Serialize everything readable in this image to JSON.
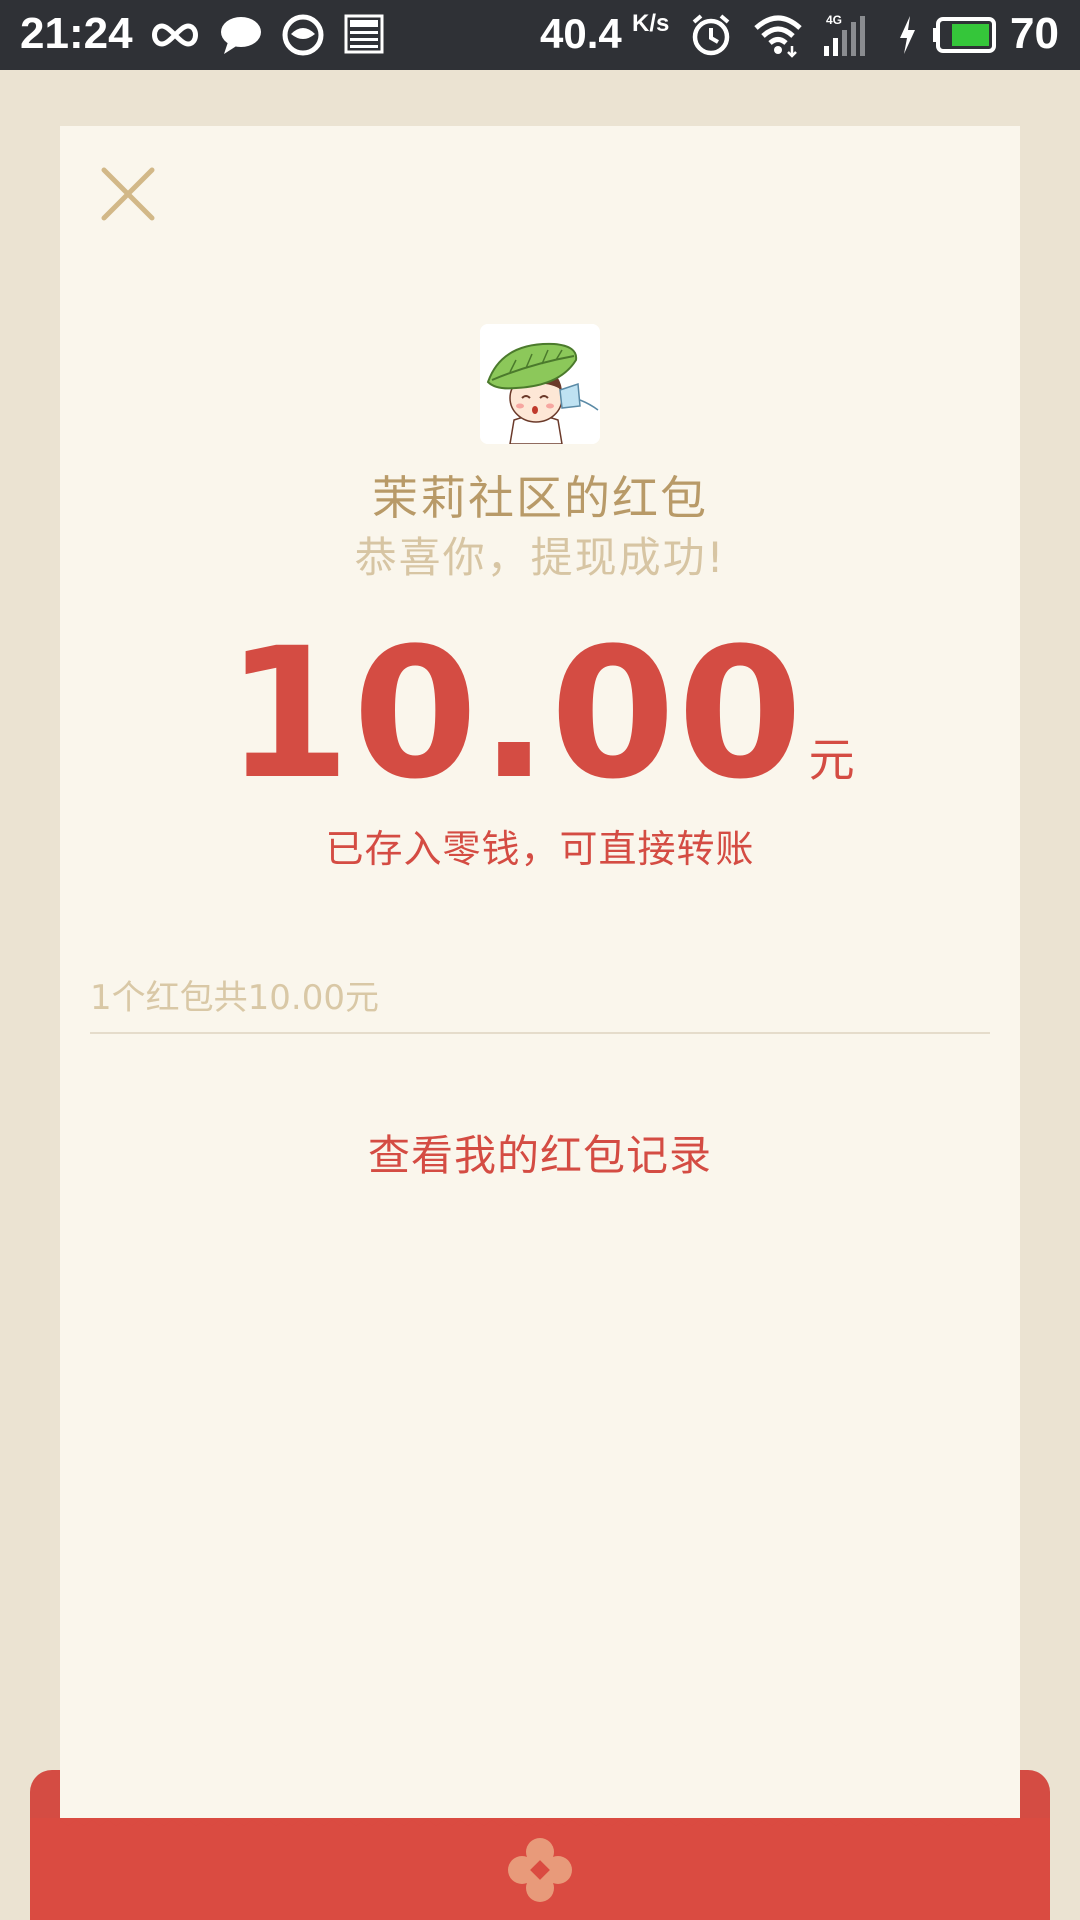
{
  "status_bar": {
    "time": "21:24",
    "net_speed": "40.4",
    "net_speed_unit": "K/s",
    "network_type": "4G",
    "battery_percent": "70",
    "icons": [
      "infinity-icon",
      "chat-bubble-icon",
      "face-app-icon",
      "news-icon",
      "alarm-clock-icon",
      "wifi-icon",
      "cell-signal-icon",
      "charging-icon",
      "battery-icon"
    ]
  },
  "packet": {
    "title": "茉莉社区的红包",
    "subtitle": "恭喜你，提现成功!",
    "amount": "10.00",
    "amount_unit": "元",
    "note": "已存入零钱，可直接转账",
    "summary": "1个红包共10.00元",
    "records_link": "查看我的红包记录"
  },
  "colors": {
    "accent_red": "#d44c43",
    "gold_text": "#b89a68",
    "light_gold_text": "#d7c5a3",
    "card_bg": "#faf6ec",
    "page_bg": "#ebe3d2",
    "status_bar_bg": "#2f3136"
  }
}
